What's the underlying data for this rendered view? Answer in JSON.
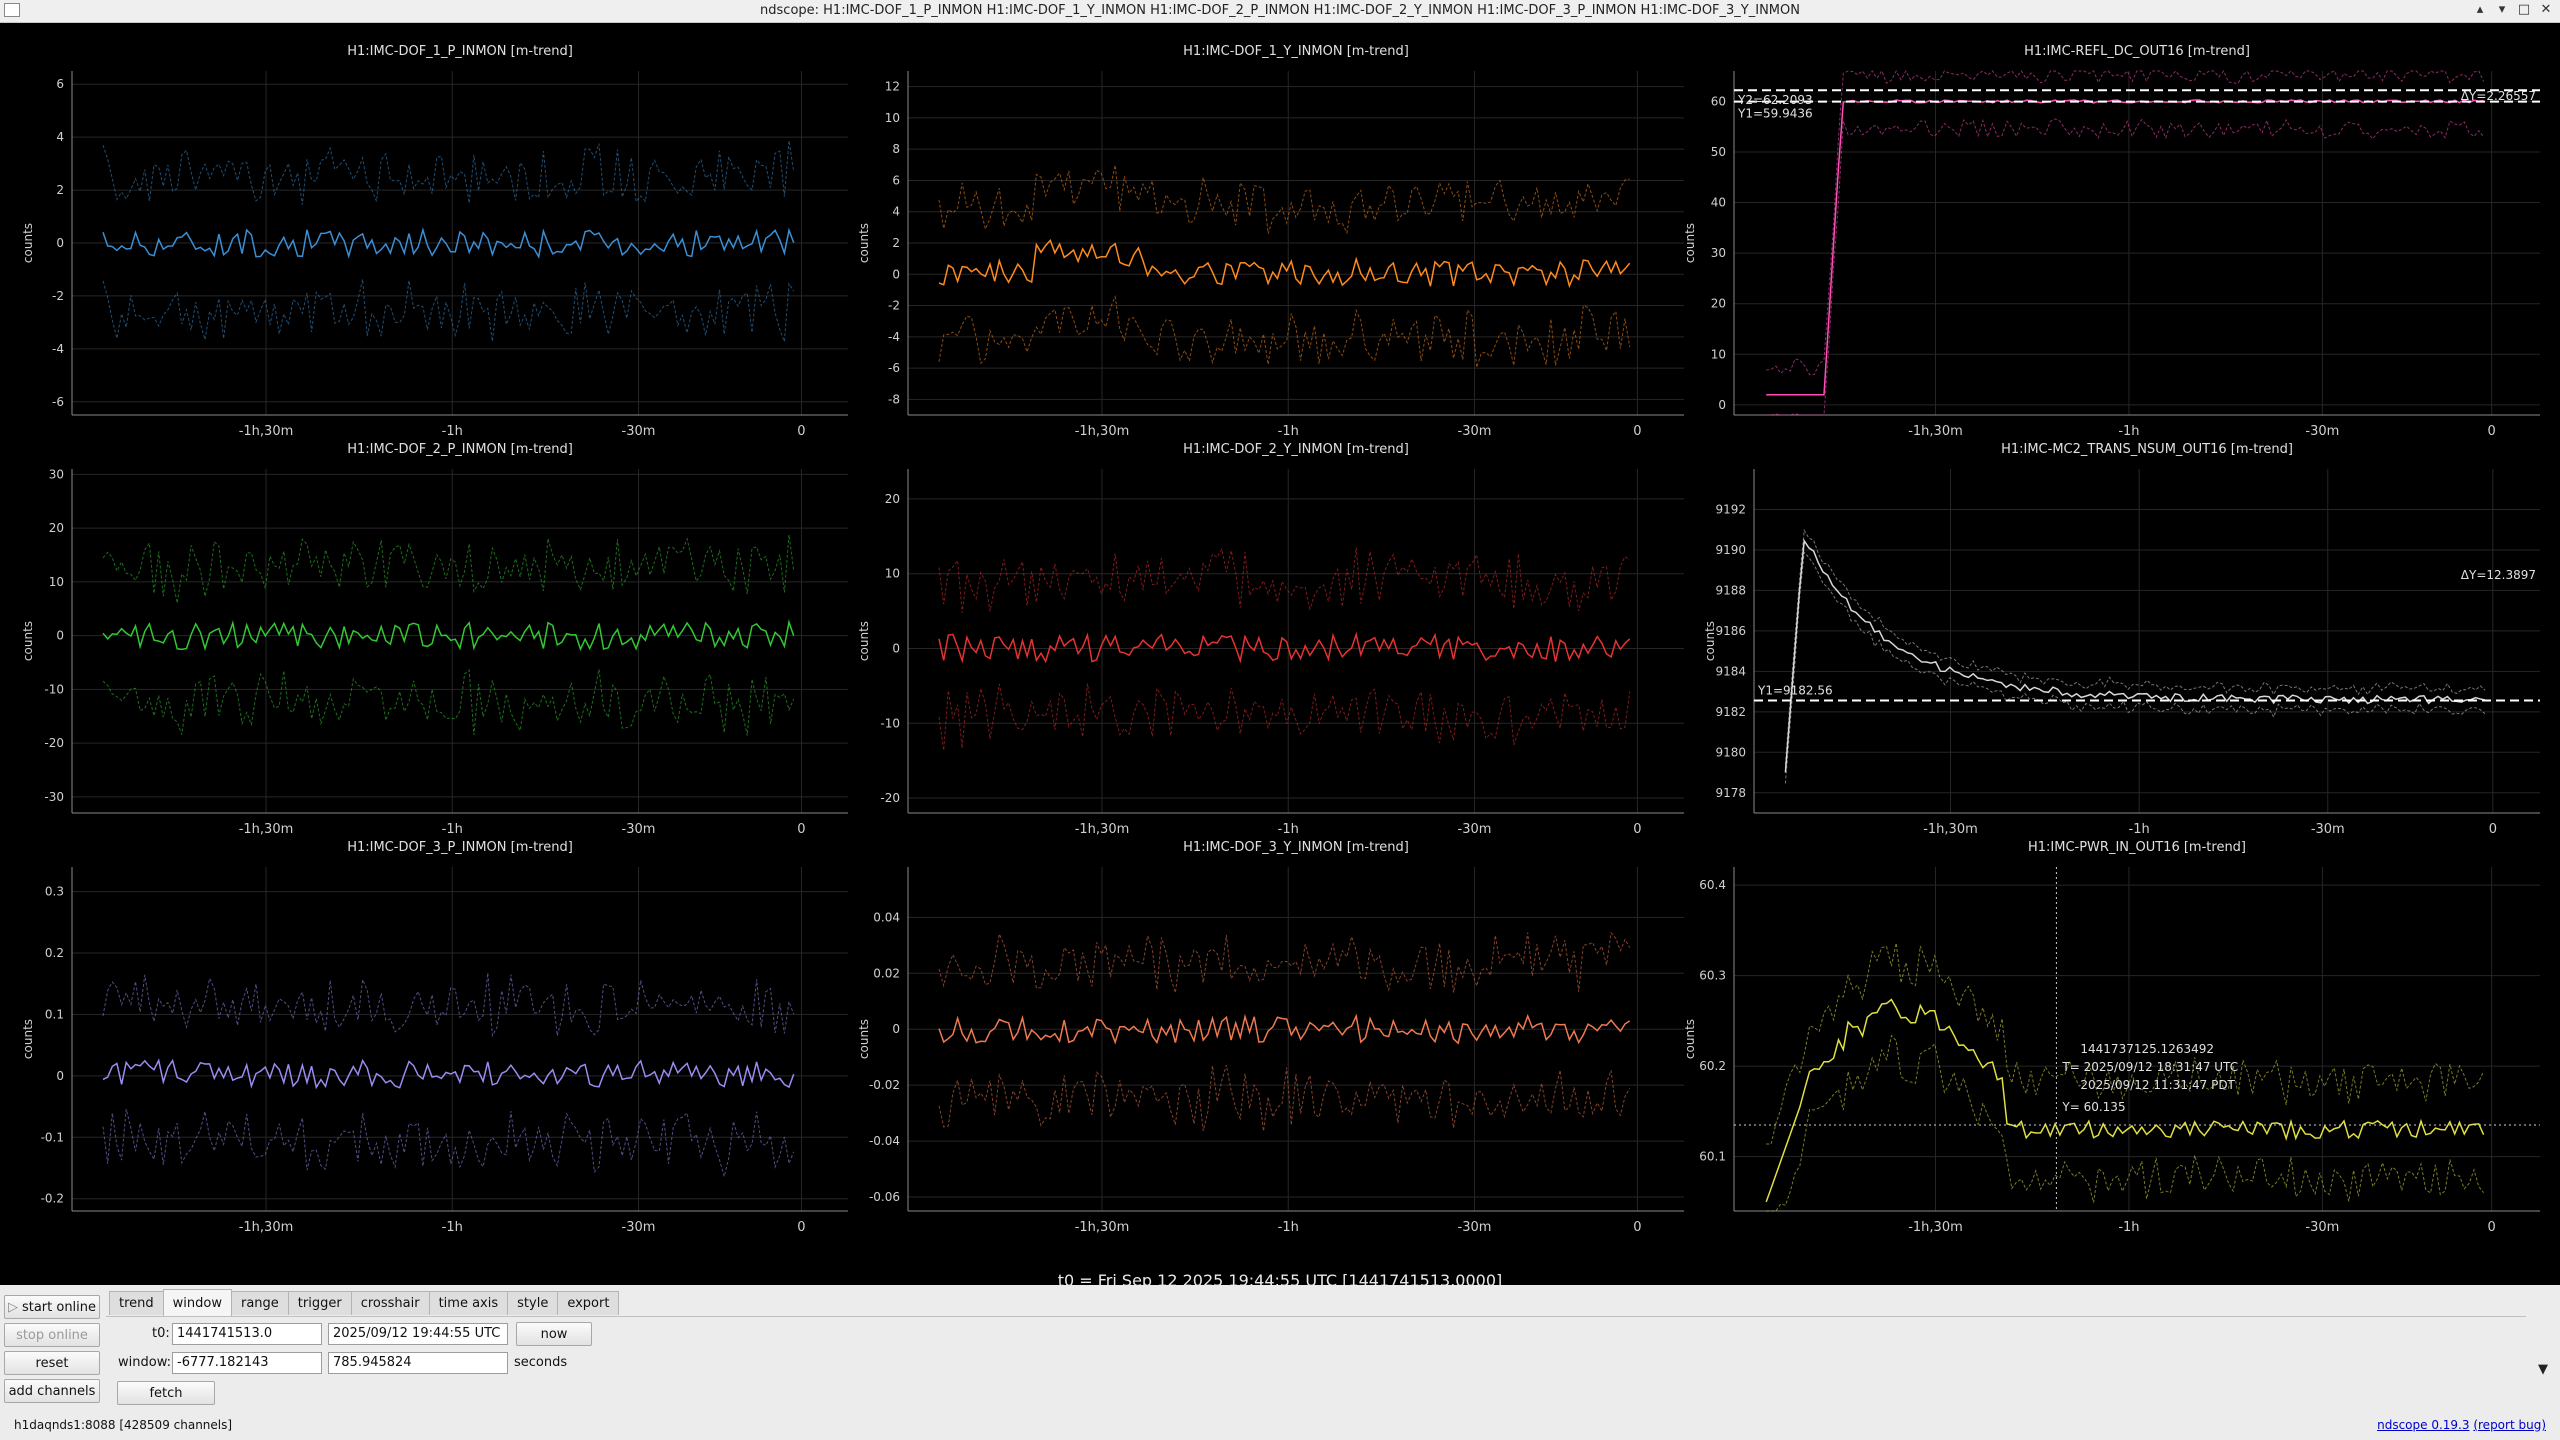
{
  "window": {
    "title": "ndscope: H1:IMC-DOF_1_P_INMON H1:IMC-DOF_1_Y_INMON H1:IMC-DOF_2_P_INMON H1:IMC-DOF_2_Y_INMON H1:IMC-DOF_3_P_INMON H1:IMC-DOF_3_Y_INMON",
    "buttons": [
      "▴",
      "▾",
      "□",
      "✕"
    ]
  },
  "t0_label": "t0 = Fri Sep 12 2025 19:44:55 UTC [1441741513.0000]",
  "x_ticks": [
    "-1h,30m",
    "-1h",
    "-30m",
    "0"
  ],
  "y_label": "counts",
  "plots": [
    {
      "title": "H1:IMC-DOF_1_P_INMON [m-trend]",
      "color": "#3a8fd6",
      "yticks": [
        "6",
        "4",
        "2",
        "0",
        "-2",
        "-4",
        "-6"
      ],
      "ylim": [
        -6.5,
        6.5
      ]
    },
    {
      "title": "H1:IMC-DOF_1_Y_INMON [m-trend]",
      "color": "#ff8a1e",
      "yticks": [
        "12",
        "10",
        "8",
        "6",
        "4",
        "2",
        "0",
        "-2",
        "-4",
        "-6",
        "-8"
      ],
      "ylim": [
        -9,
        13
      ]
    },
    {
      "title": "H1:IMC-REFL_DC_OUT16 [m-trend]",
      "color": "#ff4fb8",
      "yticks": [
        "60",
        "50",
        "40",
        "30",
        "20",
        "10",
        "0"
      ],
      "ylim": [
        -2,
        66
      ],
      "cursor_labels": {
        "y2": "Y2=62.2093",
        "y1": "Y1=59.9436",
        "dy": "ΔY=2.26557"
      }
    },
    {
      "title": "H1:IMC-DOF_2_P_INMON [m-trend]",
      "color": "#33c833",
      "yticks": [
        "30",
        "20",
        "10",
        "0",
        "-10",
        "-20",
        "-30"
      ],
      "ylim": [
        -33,
        31
      ]
    },
    {
      "title": "H1:IMC-DOF_2_Y_INMON [m-trend]",
      "color": "#e63232",
      "yticks": [
        "20",
        "10",
        "0",
        "-10",
        "-20"
      ],
      "ylim": [
        -22,
        24
      ]
    },
    {
      "title": "H1:IMC-MC2_TRANS_NSUM_OUT16 [m-trend]",
      "color": "#d8d8d8",
      "yticks": [
        "9192",
        "9190",
        "9188",
        "9186",
        "9184",
        "9182",
        "9180",
        "9178"
      ],
      "ylim": [
        9177,
        9194
      ],
      "cursor_labels": {
        "y1": "Y1=9182.56",
        "dy": "ΔY=12.3897"
      }
    },
    {
      "title": "H1:IMC-DOF_3_P_INMON [m-trend]",
      "color": "#9a8cf0",
      "yticks": [
        "0.3",
        "0.2",
        "0.1",
        "0",
        "-0.1",
        "-0.2"
      ],
      "ylim": [
        -0.22,
        0.34
      ]
    },
    {
      "title": "H1:IMC-DOF_3_Y_INMON [m-trend]",
      "color": "#f07a50",
      "yticks": [
        "0.04",
        "0.02",
        "0",
        "-0.02",
        "-0.04",
        "-0.06"
      ],
      "ylim": [
        -0.065,
        0.058
      ]
    },
    {
      "title": "H1:IMC-PWR_IN_OUT16 [m-trend]",
      "color": "#e0e040",
      "yticks": [
        "60.4",
        "60.3",
        "60.2",
        "60.1"
      ],
      "ylim": [
        60.04,
        60.42
      ],
      "crosshair": {
        "gps": "1441737125.1263492",
        "t_utc": "T= 2025/09/12 18:31:47 UTC",
        "t_pdt": "2025/09/12 11:31:47 PDT",
        "y": "Y= 60.135"
      }
    }
  ],
  "controls": {
    "start_online": "start online",
    "stop_online": "stop online",
    "reset": "reset",
    "add_channels": "add channels",
    "tabs": [
      "trend",
      "window",
      "range",
      "trigger",
      "crosshair",
      "time axis",
      "style",
      "export"
    ],
    "active_tab": "window",
    "t0_label": "t0:",
    "t0_gps": "1441741513.0",
    "t0_date": "2025/09/12 19:44:55 UTC",
    "now": "now",
    "window_label": "window:",
    "window_start": "-6777.182143",
    "window_end": "785.945824",
    "seconds": "seconds",
    "fetch": "fetch",
    "dropdown_arrow": "▼"
  },
  "status": {
    "server": "h1daqnds1:8088  [428509 channels]",
    "version_link": "ndscope 0.19.3",
    "bug_link": "(report bug)"
  }
}
